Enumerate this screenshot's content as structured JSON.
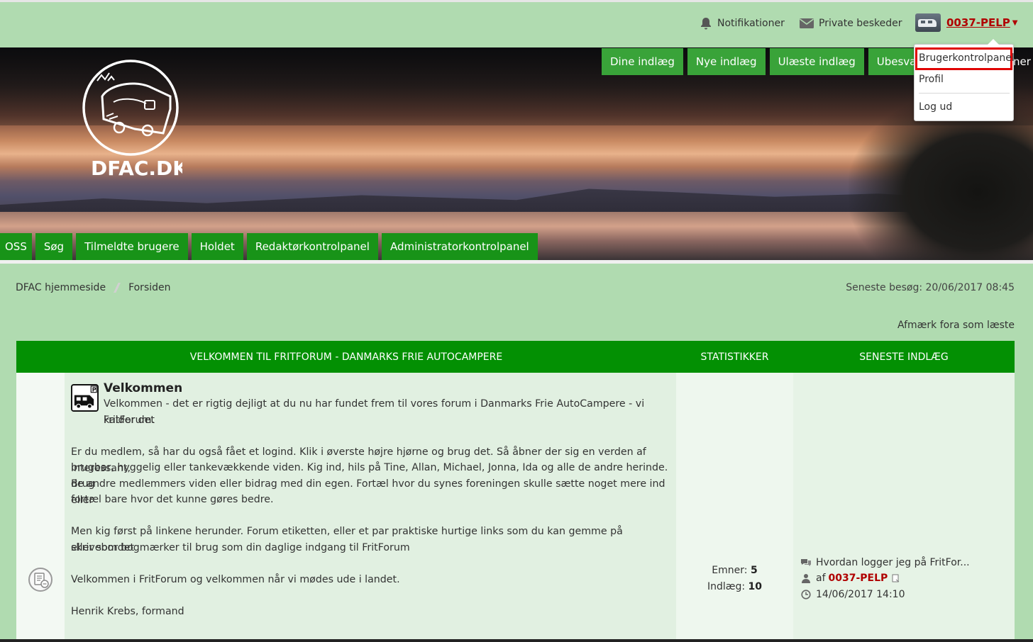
{
  "topbar": {
    "notifications": "Notifikationer",
    "messages": "Private beskeder",
    "username": "0037-PELP",
    "caret": "▼"
  },
  "logo_text": "DFAC.DK",
  "nav_top": [
    "Dine indlæg",
    "Nye indlæg",
    "Ulæste indlæg",
    "Ubesvarede i"
  ],
  "nav_top_overflow": "ner",
  "nav_bottom": [
    "OSS",
    "Søg",
    "Tilmeldte brugere",
    "Holdet",
    "Redaktørkontrolpanel",
    "Administratorkontrolpanel"
  ],
  "dropdown": {
    "items": [
      "Brugerkontrolpanel",
      "Profil",
      "Log ud"
    ],
    "highlighted": "Brugerkontrolpanel"
  },
  "breadcrumb": [
    "DFAC hjemmeside",
    "Forsiden"
  ],
  "last_visit": "Seneste besøg: 20/06/2017 08:45",
  "mark_read": "Afmærk fora som læste",
  "table": {
    "headers": [
      "VELKOMMEN TIL FRITFORUM - DANMARKS FRIE AUTOCAMPERE",
      "STATISTIKKER",
      "SENESTE INDLÆG"
    ]
  },
  "forum": {
    "title": "Velkommen",
    "desc": [
      "Velkommen - det er rigtig dejligt at du nu har fundet frem til vores forum i Danmarks Frie AutoCampere - vi kalder det",
      "FritForum.",
      "Er du medlem, så har du også fået et logind. Klik i øverste højre hjørne og brug det. Så åbner der sig en verden af interessant,",
      "brugbar, hyggelig eller tankevækkende viden. Kig ind, hils på Tine, Allan, Michael, Jonna, Ida og alle de andre herinde. Brug",
      "de andre medlemmers viden eller bidrag med din egen. Fortæl hvor du synes foreningen skulle sætte noget mere ind eller",
      "fortæl bare hvor det kunne gøres bedre.",
      "Men kig først på linkene herunder. Forum etiketten, eller et par praktiske hurtige links som du kan gemme på skrivebordet",
      "eller som bogmærker til brug som din daglige indgang til FritForum",
      "Velkommen i FritForum og velkommen når vi mødes ude i landet.",
      "Henrik Krebs, formand"
    ],
    "stats": {
      "topics_label": "Emner:",
      "topics": "5",
      "posts_label": "Indlæg:",
      "posts": "10"
    },
    "last_post": {
      "title": "Hvordan logger jeg på FritFor...",
      "by": "af",
      "author": "0037-PELP",
      "time": "14/06/2017 14:10"
    }
  },
  "colors": {
    "page_bg": "#b0dbb0",
    "nav_green": "#39a339",
    "header_green": "#039003",
    "user_red": "#b00000",
    "highlight_red": "#e00000"
  }
}
